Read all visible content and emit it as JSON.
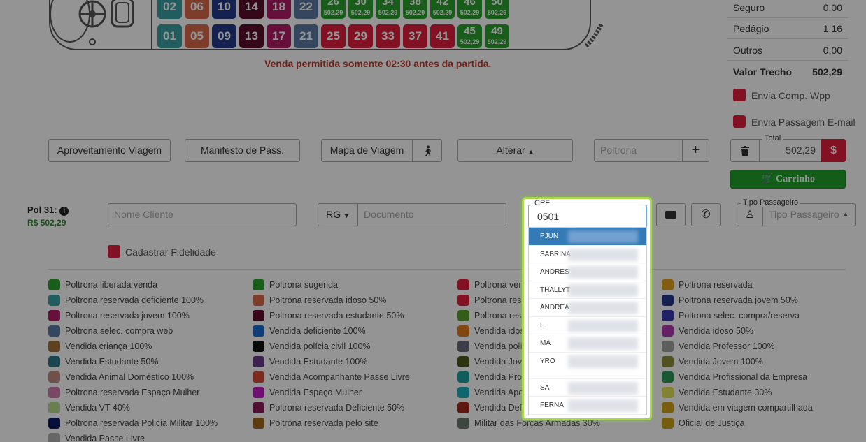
{
  "seats_top": [
    {
      "n": "02",
      "color": "#3aa0a3"
    },
    {
      "n": "06",
      "color": "#d96a4a"
    },
    {
      "n": "10",
      "color": "#253b8c"
    },
    {
      "n": "14",
      "color": "#5a0f2a"
    },
    {
      "n": "18",
      "color": "#b21c66"
    },
    {
      "n": "22",
      "color": "#5a7ba3"
    },
    {
      "n": "26",
      "price": "502,29",
      "color": "#2aa02e"
    },
    {
      "n": "30",
      "price": "502,29",
      "color": "#2aa02e"
    },
    {
      "n": "34",
      "price": "502,29",
      "color": "#2aa02e"
    },
    {
      "n": "38",
      "price": "502,29",
      "color": "#2aa02e"
    },
    {
      "n": "42",
      "price": "502,29",
      "color": "#2aa02e"
    },
    {
      "n": "46",
      "price": "502,29",
      "color": "#2aa02e"
    },
    {
      "n": "50",
      "price": "502,29",
      "color": "#2aa02e"
    }
  ],
  "seats_bottom": [
    {
      "n": "01",
      "color": "#3aa0a3"
    },
    {
      "n": "05",
      "color": "#d96a4a"
    },
    {
      "n": "09",
      "color": "#253b8c"
    },
    {
      "n": "13",
      "color": "#5a0f2a"
    },
    {
      "n": "17",
      "color": "#b21c66"
    },
    {
      "n": "21",
      "color": "#5a7ba3"
    },
    {
      "n": "25",
      "color": "#e01f3d"
    },
    {
      "n": "29",
      "color": "#e01f3d"
    },
    {
      "n": "33",
      "color": "#e01f3d"
    },
    {
      "n": "37",
      "color": "#e01f3d"
    },
    {
      "n": "41",
      "color": "#e01f3d"
    },
    {
      "n": "45",
      "price": "502,29",
      "color": "#2aa02e"
    },
    {
      "n": "49",
      "price": "502,29",
      "color": "#2aa02e"
    }
  ],
  "warning": "Venda permitida somente 02:30 antes da partida.",
  "summary": {
    "rows": [
      {
        "label": "Seguro",
        "value": "0,00"
      },
      {
        "label": "Pedágio",
        "value": "1,16"
      },
      {
        "label": "Outros",
        "value": "0,00"
      }
    ],
    "total_label": "Valor Trecho",
    "total_value": "502,29",
    "wpp": "Envia Comp. Wpp",
    "email": "Envia Passagem E-mail"
  },
  "toolbar": {
    "aproveitamento": "Aproveitamento Viagem",
    "manifesto": "Manifesto de Pass.",
    "mapa": "Mapa de Viagem",
    "alterar": "Alterar",
    "poltrona_placeholder": "Poltrona",
    "total_label": "Total",
    "total_value": "502,29",
    "currency": "$",
    "cart": "Carrinho"
  },
  "passenger": {
    "pol_label": "Pol 31:",
    "pol_price": "R$ 502,29",
    "nome_placeholder": "Nome Cliente",
    "doc_type": "RG",
    "doc_placeholder": "Documento",
    "tipo_label": "Tipo Passageiro",
    "tipo_placeholder": "Tipo Passageiro",
    "fidelidade": "Cadastrar Fidelidade"
  },
  "cpf": {
    "label": "CPF",
    "value": "0501",
    "suggestions": [
      "PJUN",
      "SABRINA",
      "ANDRES",
      "THALLYT",
      "ANDREA",
      "L",
      "MA",
      "YRO",
      "SA",
      "FERNA"
    ]
  },
  "legend": [
    [
      {
        "label": "Poltrona liberada venda",
        "color": "#2aa02e"
      },
      {
        "label": "Poltrona reservada deficiente 100%",
        "color": "#3aa0a3"
      },
      {
        "label": "Poltrona reservada jovem 100%",
        "color": "#b21c66"
      },
      {
        "label": "Poltrona selec. compra web",
        "color": "#5a7ba3"
      },
      {
        "label": "Vendida criança 100%",
        "color": "#a0703a"
      },
      {
        "label": "Vendida Estudante 50%",
        "color": "#2a7a8c"
      },
      {
        "label": "Vendida Animal Doméstico 100%",
        "color": "#c08a80"
      },
      {
        "label": "Poltrona reservada Espaço Mulher",
        "color": "#d07aa8"
      },
      {
        "label": "Vendida VT 40%",
        "color": "#b8d890"
      },
      {
        "label": "Poltrona reservada Policia Militar 100%",
        "color": "#101a6a"
      },
      {
        "label": "Vendida Passe Livre",
        "color": "#b0b0b0"
      }
    ],
    [
      {
        "label": "Poltrona sugerida",
        "color": "#2aa02e"
      },
      {
        "label": "Poltrona reservada idoso 50%",
        "color": "#d96a4a"
      },
      {
        "label": "Poltrona reservada estudante 50%",
        "color": "#5a0f2a"
      },
      {
        "label": "Vendida deficiente 100%",
        "color": "#1a6ad0"
      },
      {
        "label": "Vendida polícia civil 100%",
        "color": "#101010"
      },
      {
        "label": "Vendida Estudante 100%",
        "color": "#6a3a8c"
      },
      {
        "label": "Vendida Acompanhante Passe Livre",
        "color": "#d84a3a"
      },
      {
        "label": "Vendida Espaço Mulher",
        "color": "#c01ac0"
      },
      {
        "label": "Poltrona reservada Deficiente 50%",
        "color": "#8c1a5a"
      },
      {
        "label": "Poltrona reservada pelo site",
        "color": "#a06a1a"
      }
    ],
    [
      {
        "label": "Poltrona vend",
        "color": "#e01f3d"
      },
      {
        "label": "Poltrona rese",
        "color": "#e01f3d"
      },
      {
        "label": "Poltrona rese",
        "color": "#5aa02e"
      },
      {
        "label": "Vendida idos",
        "color": "#e07a1a"
      },
      {
        "label": "Vendida polí",
        "color": "#6a6a7a"
      },
      {
        "label": "Vendida Jove",
        "color": "#4a5a1a"
      },
      {
        "label": "Vendida Profi",
        "color": "#1aa0a0"
      },
      {
        "label": "Vendida Apos",
        "color": "#1ab0c0"
      },
      {
        "label": "Vendida Defi",
        "color": "#a02a1a"
      },
      {
        "label": "Militar das Forças Armadas 30%",
        "color": "#6a7a6a"
      }
    ],
    [
      {
        "label": "Poltrona reservada",
        "color": "#e0a01a"
      },
      {
        "label": "Poltrona reservada jovem 50%",
        "color": "#253b8c"
      },
      {
        "label": "Poltrona selec. compra/reserva",
        "color": "#3a3ab0"
      },
      {
        "label": "Vendida idoso 50%",
        "color": "#b03ab0"
      },
      {
        "label": "Vendida Professor 100%",
        "color": "#a0a0a0"
      },
      {
        "label": "Vendida Jovem 100%",
        "color": "#8c8c3a"
      },
      {
        "label": "Vendida Profissional da Empresa",
        "color": "#2a9a5a"
      },
      {
        "label": "Vendida Estudante 30%",
        "color": "#e0e05a"
      },
      {
        "label": "Vendida em viagem compartilhada",
        "color": "#d0a01a"
      },
      {
        "label": "Oficial de Justiça",
        "color": "#c8a01a"
      }
    ]
  ]
}
